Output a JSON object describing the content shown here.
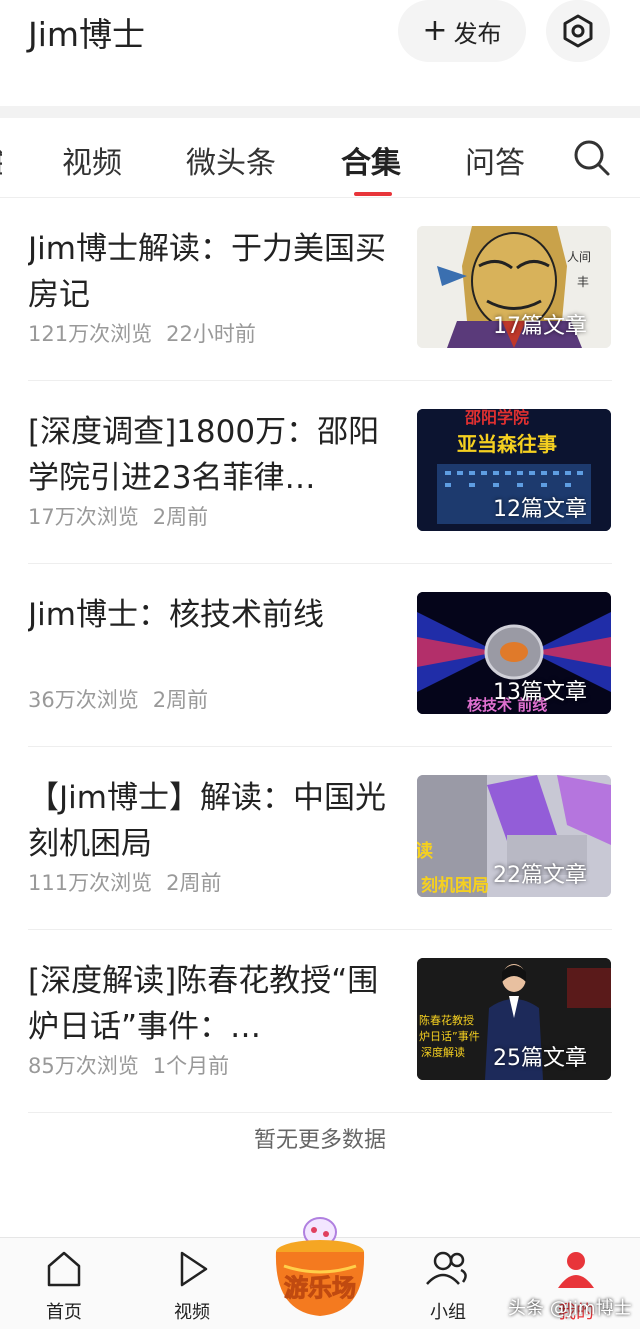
{
  "header": {
    "title": "Jim博士",
    "publish_label": "发布"
  },
  "tabs": [
    {
      "label": "视频"
    },
    {
      "label": "微头条"
    },
    {
      "label": "合集",
      "active": true
    },
    {
      "label": "问答"
    }
  ],
  "collections": [
    {
      "title": "Jim博士解读：于力美国买房记",
      "views": "121万次浏览",
      "time": "22小时前",
      "count": "17篇文章"
    },
    {
      "title": "[深度调查]1800万：邵阳学院引进23名菲律…",
      "views": "17万次浏览",
      "time": "2周前",
      "count": "12篇文章",
      "thumb_text": {
        "top": "邵阳学院",
        "mid": "亚当森往事"
      }
    },
    {
      "title": "Jim博士：核技术前线",
      "views": "36万次浏览",
      "time": "2周前",
      "count": "13篇文章",
      "thumb_text": {
        "bottom": "核技术 前线"
      }
    },
    {
      "title": "【Jim博士】解读：中国光刻机困局",
      "views": "111万次浏览",
      "time": "2周前",
      "count": "22篇文章",
      "thumb_text": {
        "left": "读",
        "bottom": "刻机困局"
      }
    },
    {
      "title": "[深度解读]陈春花教授“围炉日话”事件：…",
      "views": "85万次浏览",
      "time": "1个月前",
      "count": "25篇文章",
      "thumb_text": {
        "line1": "陈春花教授",
        "line2": "炉日话”事件",
        "line3": "深度解读"
      }
    }
  ],
  "no_more_text": "暂无更多数据",
  "bottom_nav": {
    "home": "首页",
    "video": "视频",
    "playground": "游乐场",
    "group": "小组",
    "mine": "我的"
  },
  "watermark": "头条 @Jim博士",
  "colors": {
    "accent": "#e8353a",
    "text": "#222222",
    "meta": "#999999"
  }
}
